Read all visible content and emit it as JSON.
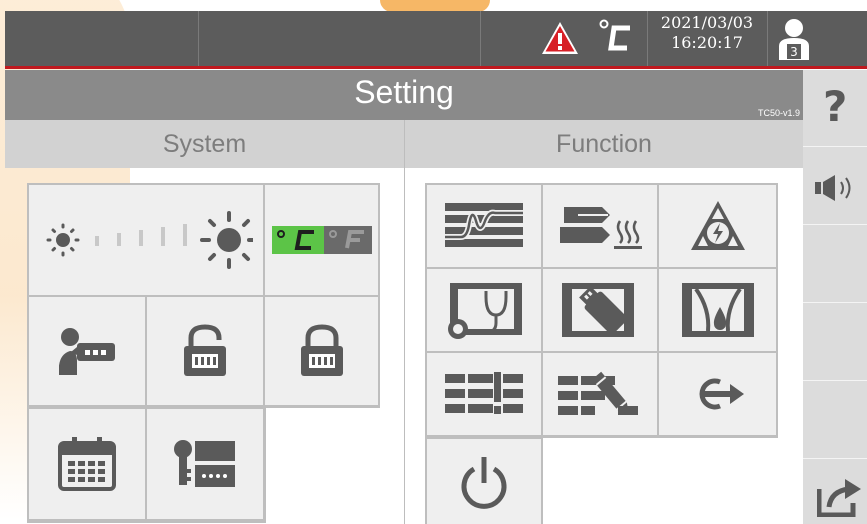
{
  "status_bar": {
    "temperature_unit_symbol": "°C",
    "date": "2021/03/03",
    "time": "16:20:17",
    "user_level": "3"
  },
  "header": {
    "title": "Setting",
    "version": "TC50-v1.9"
  },
  "sections": {
    "system": "System",
    "function": "Function"
  },
  "temperature_toggle": {
    "celsius": "°C",
    "fahrenheit": "°F",
    "selected": "celsius"
  },
  "sidebar": {
    "help_label": "?"
  },
  "colors": {
    "topbar": "#5c5c5c",
    "alarm": "#d71f26",
    "accent_green": "#5cc447",
    "header": "#8a8a8a",
    "icon": "#5a5a5a"
  }
}
